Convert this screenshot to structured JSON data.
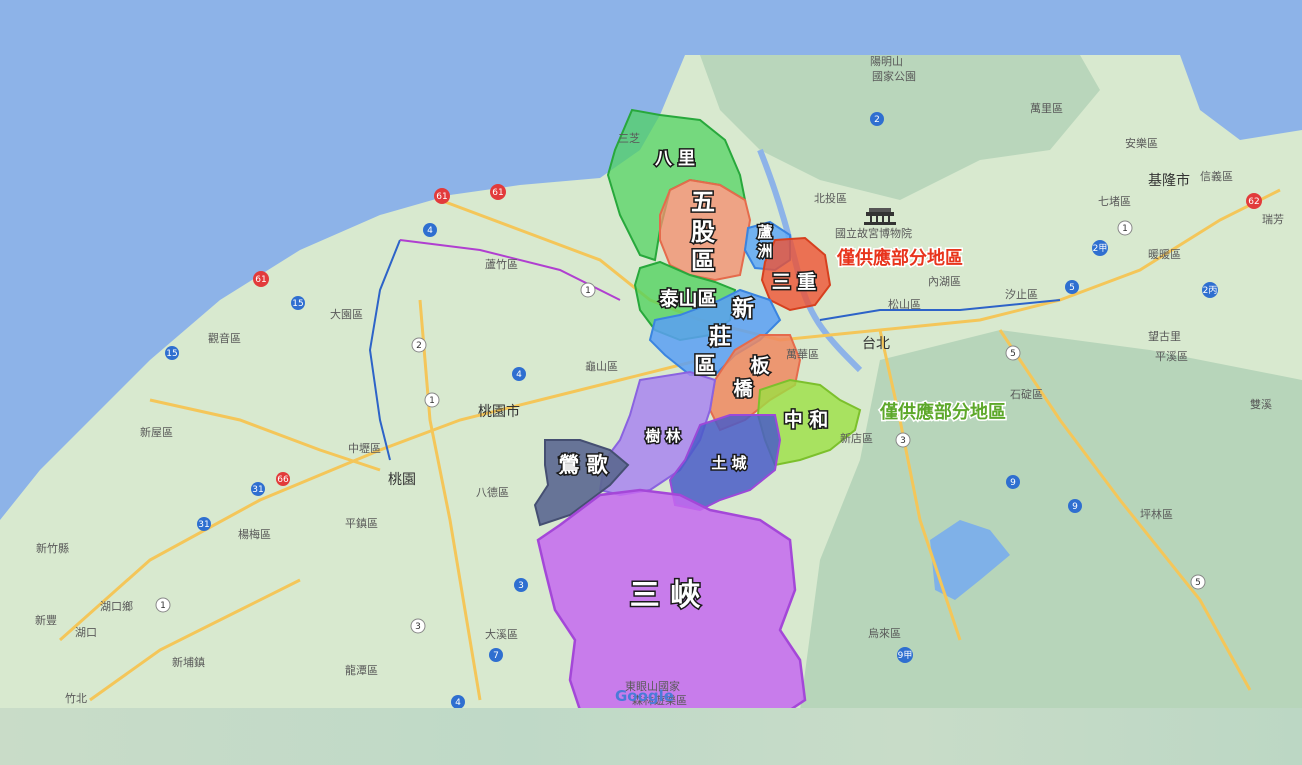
{
  "colors": {
    "sea": "#8db3e8",
    "land": "#d9e8d0",
    "mountain": "#bfd8c0",
    "highway": "#f6c85f",
    "green": "#4cd25c",
    "orange": "#f08a60",
    "blue": "#5aa0f5",
    "red": "#f0502f",
    "purple": "#c063f0",
    "lime": "#9be040",
    "navy": "#4a5cc8",
    "slate": "#5b6790",
    "lavender": "#a985f0"
  },
  "districts": {
    "bali": "八 里",
    "wugu": "五\n股\n區",
    "wugu_lines": [
      "五",
      "股",
      "區"
    ],
    "luzhou_lines": [
      "蘆",
      "洲"
    ],
    "sanchong": "三 重",
    "taishan": "泰山區",
    "xinzhuang_lines": [
      "新",
      "莊",
      "區"
    ],
    "banqiao_lines": [
      "板",
      "橋"
    ],
    "zhonghe": "中 和",
    "shulin": "樹 林",
    "tucheng": "土 城",
    "yingge": "鶯 歌",
    "sanxia": "三 峽"
  },
  "notes": {
    "partial_supply_1": "僅供應部分地區",
    "partial_supply_2": "僅供應部分地區"
  },
  "base_labels": {
    "yangmingshan": "陽明山",
    "national_park": "國家公園",
    "palace_museum": "國立故宮博物院",
    "taipei": "台北",
    "keelung": "基隆市",
    "taoyuan_city": "桃園市",
    "taoyuan": "桃園",
    "beitou": "北投區",
    "neihu": "內湖區",
    "songshan": "松山區",
    "xizhi": "汐止區",
    "wanli": "萬里區",
    "anle": "安樂區",
    "qidu": "七堵區",
    "nuannuan": "暖暖區",
    "xinyi": "信義區",
    "ruifang": "瑞芳",
    "shiding": "石碇區",
    "pingxi": "平溪區",
    "wangguli": "望古里",
    "shuangxi": "雙溪",
    "pinglin": "坪林區",
    "wulai": "烏來區",
    "xindian": "新店區",
    "wanhua": "萬華區",
    "dayuan": "大園區",
    "guanyin": "觀音區",
    "luzhu": "蘆竹區",
    "guishan": "龜山區",
    "zhongli": "中壢區",
    "bade": "八德區",
    "pingzhen": "平鎮區",
    "yangmei": "楊梅區",
    "xinwu": "新屋區",
    "xinfeng": "新豐",
    "hukou": "湖口",
    "hukou_township": "湖口鄉",
    "xinpu": "新埔鎮",
    "daxi": "大溪區",
    "longtan": "龍潭區",
    "zhubei": "竹北",
    "xinzhu_county": "新竹縣",
    "dongyan": "東眼山國家",
    "forest": "森林遊樂區",
    "google": "Google",
    "xindian_short": "新店",
    "tamsui": "三芝"
  },
  "route_numbers": [
    "61",
    "61",
    "61",
    "4",
    "15",
    "15",
    "2",
    "1",
    "1",
    "4",
    "31",
    "66",
    "31",
    "3",
    "3",
    "7",
    "4",
    "2",
    "9",
    "9",
    "5",
    "5",
    "3",
    "1",
    "62",
    "2甲",
    "2丙",
    "9甲",
    "5",
    "1"
  ]
}
